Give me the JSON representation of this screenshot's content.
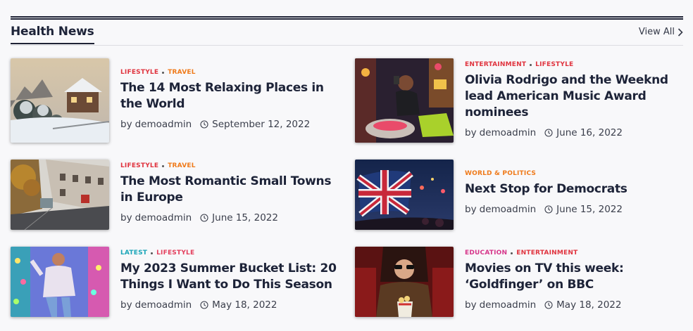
{
  "section": {
    "title": "Health News",
    "view_all": "View All"
  },
  "posts": [
    {
      "categories": [
        {
          "label": "LIFESTYLE",
          "color": "#e0333e"
        },
        {
          "label": "TRAVEL",
          "color": "#ef7a1a"
        }
      ],
      "title": "The 14 Most Relaxing Places in the World",
      "by": "by",
      "author": "demoadmin",
      "date": "September 12, 2022"
    },
    {
      "categories": [
        {
          "label": "ENTERTAINMENT",
          "color": "#e0333e"
        },
        {
          "label": "LIFESTYLE",
          "color": "#e0333e"
        }
      ],
      "title": "Olivia Rodrigo and the Weeknd lead American Music Award nominees",
      "by": "by",
      "author": "demoadmin",
      "date": "June 16, 2022"
    },
    {
      "categories": [
        {
          "label": "LIFESTYLE",
          "color": "#e0333e"
        },
        {
          "label": "TRAVEL",
          "color": "#ef7a1a"
        }
      ],
      "title": "The Most Romantic Small Towns in Europe",
      "by": "by",
      "author": "demoadmin",
      "date": "June 15, 2022"
    },
    {
      "categories": [
        {
          "label": "WORLD & POLITICS",
          "color": "#ef7a1a"
        }
      ],
      "title": "Next Stop for Democrats",
      "by": "by",
      "author": "demoadmin",
      "date": "June 15, 2022"
    },
    {
      "categories": [
        {
          "label": "LATEST",
          "color": "#1aa5b8"
        },
        {
          "label": "LIFESTYLE",
          "color": "#e33e5c"
        }
      ],
      "title": "My 2023 Summer Bucket List: 20 Things I Want to Do This Season",
      "by": "by",
      "author": "demoadmin",
      "date": "May 18, 2022"
    },
    {
      "categories": [
        {
          "label": "EDUCATION",
          "color": "#d6368a"
        },
        {
          "label": "ENTERTAINMENT",
          "color": "#e0333e"
        }
      ],
      "title": "Movies on TV this week: ‘Goldfinger’ on BBC",
      "by": "by",
      "author": "demoadmin",
      "date": "May 18, 2022"
    }
  ],
  "icons": {
    "view_all": "chevron-right-icon",
    "date": "clock-icon"
  }
}
